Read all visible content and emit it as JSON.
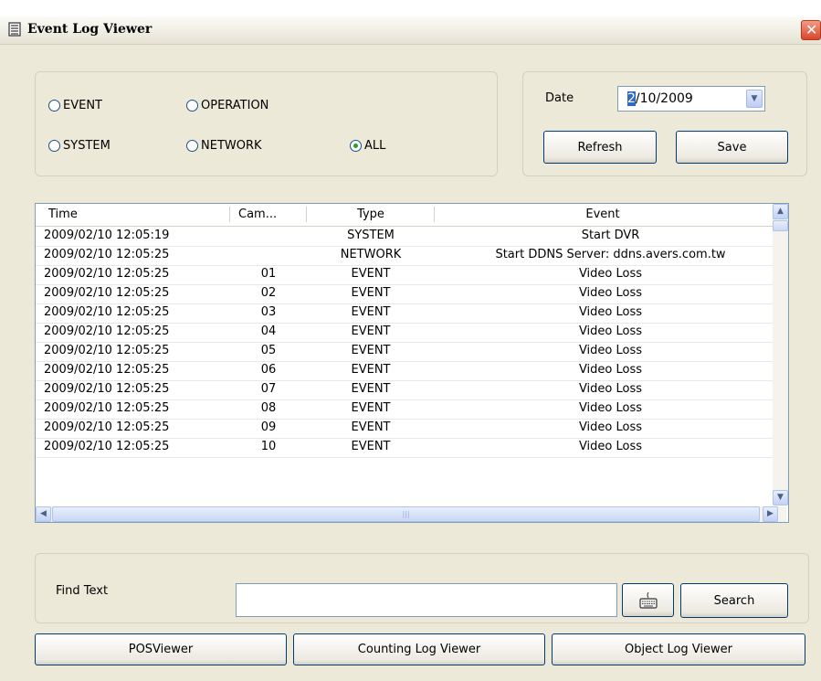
{
  "window": {
    "title": "Event Log Viewer",
    "title_icon": "list-icon",
    "close_icon": "close-icon",
    "close_glyph": "✕"
  },
  "filters": {
    "options": [
      "EVENT",
      "OPERATION",
      "SYSTEM",
      "NETWORK",
      "ALL"
    ],
    "selected": "ALL"
  },
  "date": {
    "label": "Date",
    "value_selected": "2",
    "value_rest": "/10/2009",
    "dropdown_glyph": "▼"
  },
  "buttons": {
    "refresh": "Refresh",
    "save": "Save",
    "search": "Search",
    "pos_viewer": "POSViewer",
    "counting_log_viewer": "Counting Log Viewer",
    "object_log_viewer": "Object Log Viewer"
  },
  "table": {
    "columns": [
      "Time",
      "Cam...",
      "Type",
      "Event"
    ],
    "rows": [
      [
        "2009/02/10 12:05:19",
        "",
        "SYSTEM",
        "Start DVR"
      ],
      [
        "2009/02/10 12:05:25",
        "",
        "NETWORK",
        "Start DDNS Server: ddns.avers.com.tw"
      ],
      [
        "2009/02/10 12:05:25",
        "01",
        "EVENT",
        "Video Loss"
      ],
      [
        "2009/02/10 12:05:25",
        "02",
        "EVENT",
        "Video Loss"
      ],
      [
        "2009/02/10 12:05:25",
        "03",
        "EVENT",
        "Video Loss"
      ],
      [
        "2009/02/10 12:05:25",
        "04",
        "EVENT",
        "Video Loss"
      ],
      [
        "2009/02/10 12:05:25",
        "05",
        "EVENT",
        "Video Loss"
      ],
      [
        "2009/02/10 12:05:25",
        "06",
        "EVENT",
        "Video Loss"
      ],
      [
        "2009/02/10 12:05:25",
        "07",
        "EVENT",
        "Video Loss"
      ],
      [
        "2009/02/10 12:05:25",
        "08",
        "EVENT",
        "Video Loss"
      ],
      [
        "2009/02/10 12:05:25",
        "09",
        "EVENT",
        "Video Loss"
      ],
      [
        "2009/02/10 12:05:25",
        "10",
        "EVENT",
        "Video Loss"
      ]
    ]
  },
  "scroll_glyphs": {
    "up": "▲",
    "down": "▼",
    "left": "◀",
    "right": "▶",
    "grip": "|||"
  },
  "find": {
    "label": "Find Text",
    "value": "",
    "keyboard_icon": "keyboard-icon"
  }
}
